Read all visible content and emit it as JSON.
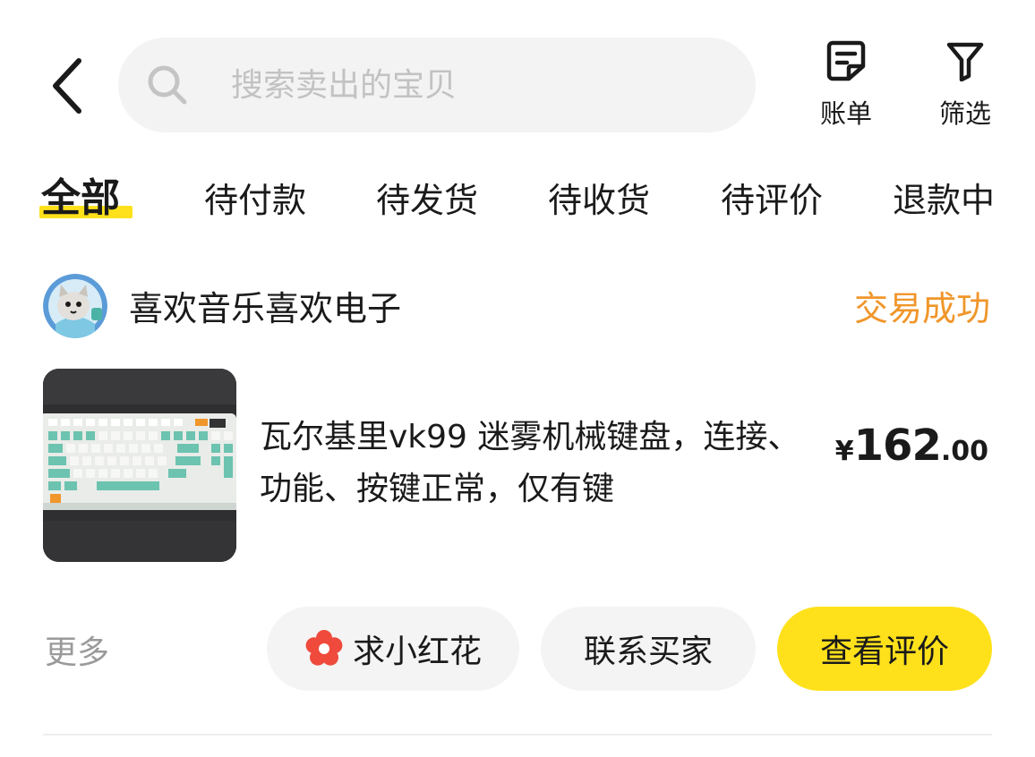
{
  "header": {
    "search_placeholder": "搜索卖出的宝贝",
    "actions": [
      {
        "label": "账单",
        "icon": "bill-icon"
      },
      {
        "label": "筛选",
        "icon": "filter-icon"
      }
    ]
  },
  "tabs": [
    {
      "label": "全部",
      "active": true
    },
    {
      "label": "待付款"
    },
    {
      "label": "待发货"
    },
    {
      "label": "待收货"
    },
    {
      "label": "待评价"
    },
    {
      "label": "退款中"
    }
  ],
  "order": {
    "seller_name": "喜欢音乐喜欢电子",
    "status": "交易成功",
    "item_title": "瓦尔基里vk99 迷雾机械键盘，连接、功能、按键正常，仅有键",
    "price": {
      "currency": "¥",
      "integer": "162",
      "decimal": ".00"
    },
    "more_label": "更多",
    "buttons": {
      "flower": "求小红花",
      "contact": "联系买家",
      "review": "查看评价"
    }
  },
  "colors": {
    "accent_yellow": "#ffe11b",
    "status_orange": "#f0962a",
    "flower_red": "#ef4a3c"
  }
}
